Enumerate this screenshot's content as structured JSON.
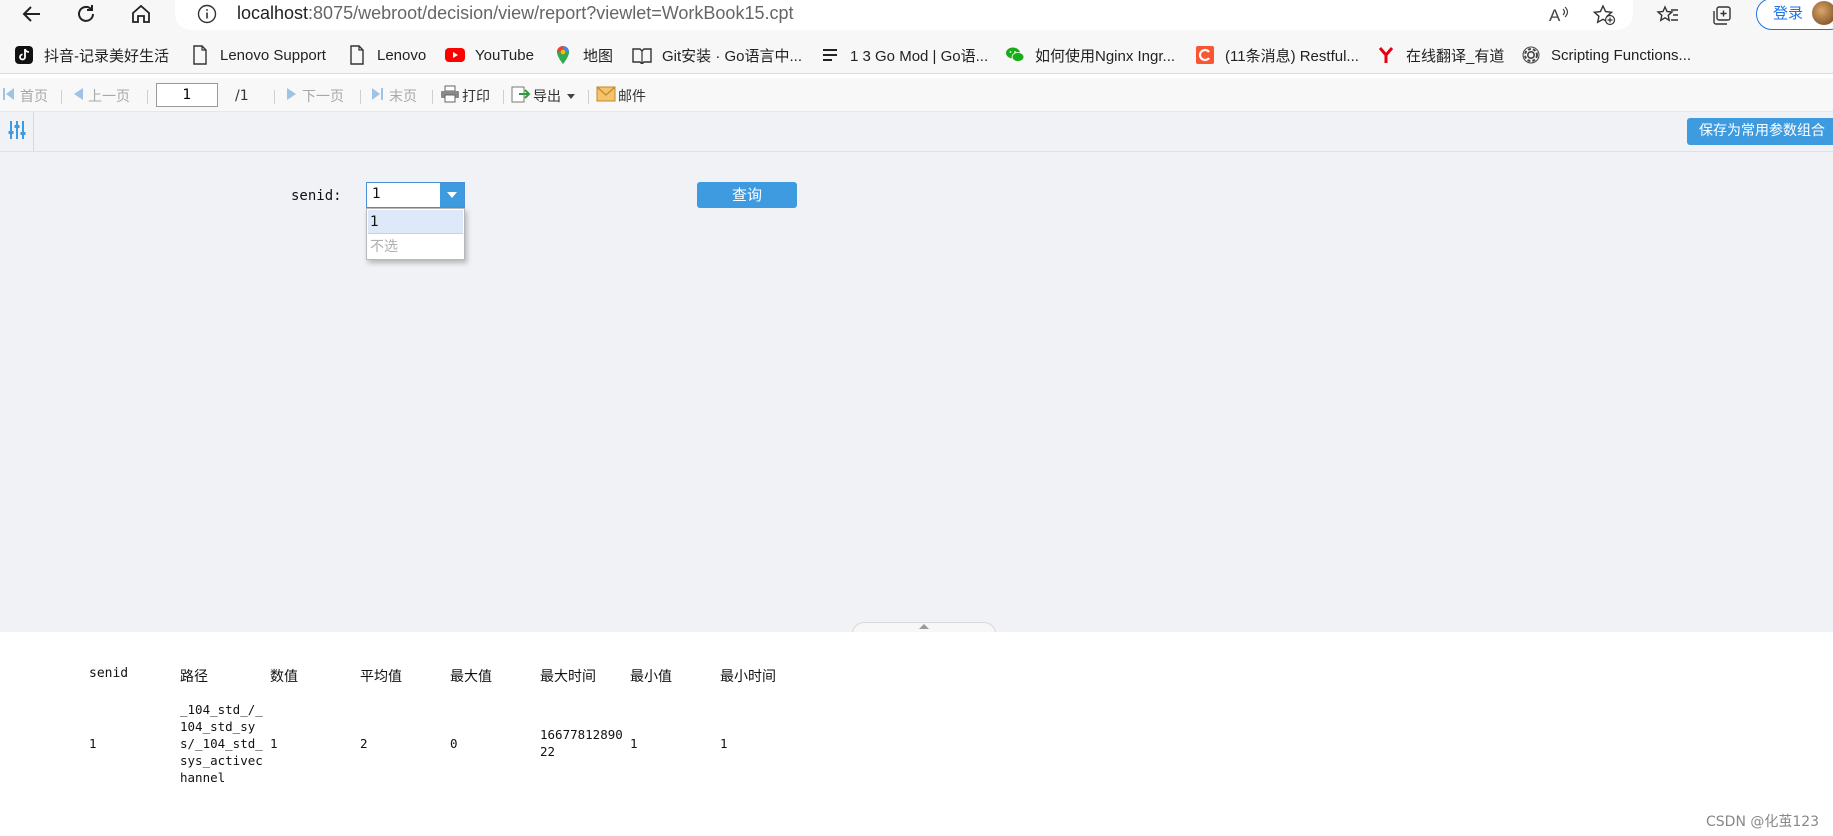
{
  "browser": {
    "url_host": "localhost",
    "url_rest": ":8075/webroot/decision/view/report?viewlet=WorkBook15.cpt",
    "login_label": "登录"
  },
  "bookmarks": [
    {
      "label": "抖音-记录美好生活",
      "icon": "tiktok-icon"
    },
    {
      "label": "Lenovo Support",
      "icon": "page-icon"
    },
    {
      "label": "Lenovo",
      "icon": "page-icon"
    },
    {
      "label": "YouTube",
      "icon": "youtube-icon"
    },
    {
      "label": "地图",
      "icon": "maps-pin-icon"
    },
    {
      "label": "Git安装 · Go语言中...",
      "icon": "book-icon"
    },
    {
      "label": "1 3 Go Mod | Go语...",
      "icon": "lines-icon"
    },
    {
      "label": "如何使用Nginx Ingr...",
      "icon": "wechat-icon"
    },
    {
      "label": "(11条消息) Restful...",
      "icon": "csdn-icon"
    },
    {
      "label": "在线翻译_有道",
      "icon": "youdao-icon"
    },
    {
      "label": "Scripting Functions...",
      "icon": "gear-icon"
    }
  ],
  "toolbar": {
    "first": "首页",
    "prev": "上一页",
    "page_value": "1",
    "page_total": "/1",
    "next": "下一页",
    "last": "末页",
    "print": "打印",
    "export": "导出",
    "mail": "邮件"
  },
  "params": {
    "save_combo_label": "保存为常用参数组合",
    "senid_label": "senid:",
    "senid_value": "1",
    "dropdown_options": [
      "1",
      "不选"
    ],
    "query_label": "查询"
  },
  "report": {
    "headers": [
      "senid",
      "路径",
      "数值",
      "平均值",
      "最大值",
      "最大时间",
      "最小值",
      "最小时间"
    ],
    "row": {
      "senid": "1",
      "path": "_104_std_/_104_std_sys/_104_std_sys_activechannel",
      "value": "1",
      "avg": "2",
      "max": "0",
      "max_time": "1667781289022",
      "min": "1",
      "min_time": "1"
    }
  },
  "watermark": "CSDN @化茧123",
  "colors": {
    "accent": "#3e9be0",
    "panel_bg": "#f0f2f5",
    "youtube_red": "#ff0000",
    "wechat_green": "#1aad19",
    "csdn_orange": "#fc5531",
    "youdao_red": "#e60012"
  }
}
